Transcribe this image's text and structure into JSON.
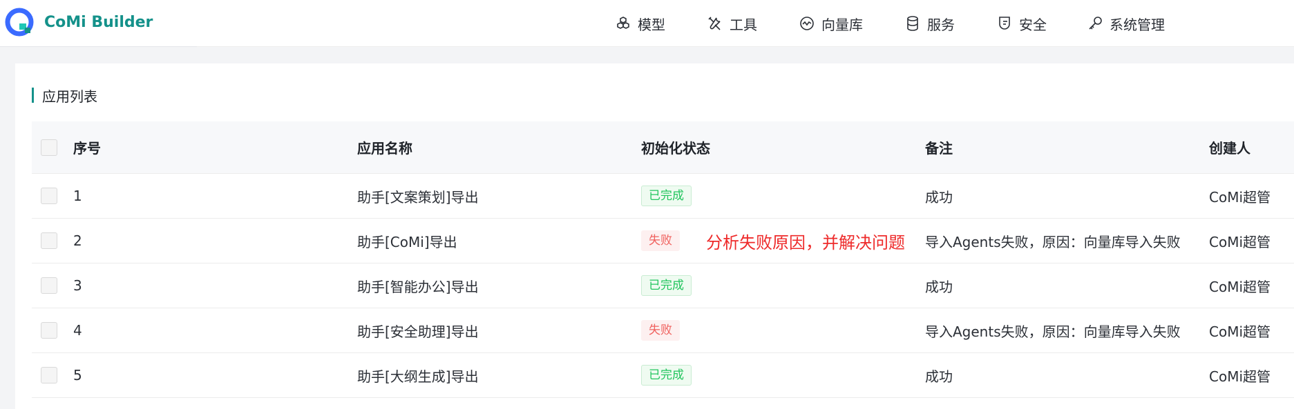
{
  "app": {
    "brand": "CoMi Builder"
  },
  "nav": [
    {
      "label": "模型",
      "icon": "model-cubes-icon"
    },
    {
      "label": "工具",
      "icon": "tools-icon"
    },
    {
      "label": "向量库",
      "icon": "vector-wave-icon"
    },
    {
      "label": "服务",
      "icon": "database-icon"
    },
    {
      "label": "安全",
      "icon": "shield-icon"
    },
    {
      "label": "系统管理",
      "icon": "key-icon"
    }
  ],
  "section": {
    "title": "应用列表"
  },
  "table": {
    "headers": [
      "序号",
      "应用名称",
      "初始化状态",
      "备注",
      "创建人"
    ],
    "rows": [
      {
        "idx": "1",
        "name": "助手[文案策划]导出",
        "status": "已完成",
        "status_type": "success",
        "note": "成功",
        "creator": "CoMi超管"
      },
      {
        "idx": "2",
        "name": "助手[CoMi]导出",
        "status": "失败",
        "status_type": "fail",
        "note": "导入Agents失败，原因：向量库导入失败",
        "creator": "CoMi超管"
      },
      {
        "idx": "3",
        "name": "助手[智能办公]导出",
        "status": "已完成",
        "status_type": "success",
        "note": "成功",
        "creator": "CoMi超管"
      },
      {
        "idx": "4",
        "name": "助手[安全助理]导出",
        "status": "失败",
        "status_type": "fail",
        "note": "导入Agents失败，原因：向量库导入失败",
        "creator": "CoMi超管"
      },
      {
        "idx": "5",
        "name": "助手[大纲生成]导出",
        "status": "已完成",
        "status_type": "success",
        "note": "成功",
        "creator": "CoMi超管"
      }
    ]
  },
  "annotation": "分析失败原因，并解决问题",
  "colors": {
    "brand": "#14918a",
    "success": "#22c55e",
    "fail": "#f0605d",
    "annotation": "#ee2a2a"
  }
}
